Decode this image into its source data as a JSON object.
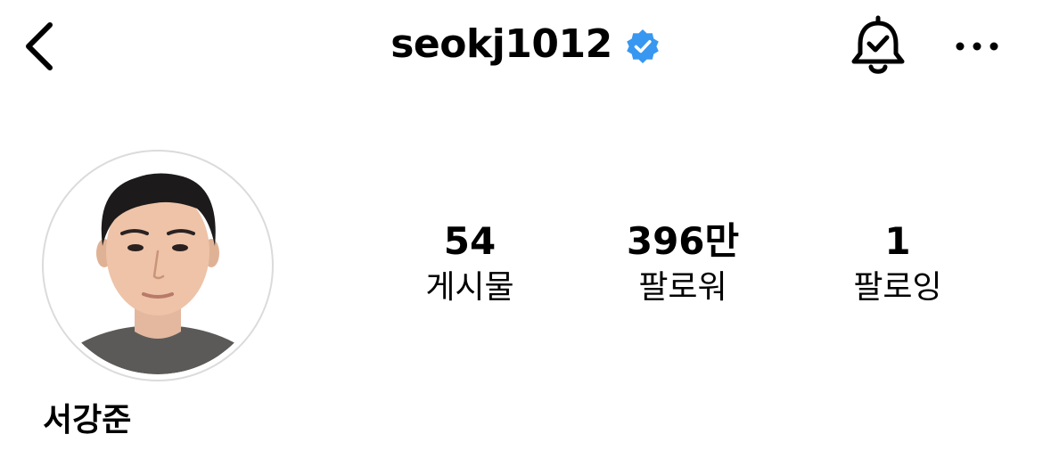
{
  "header": {
    "username": "seokj1012",
    "verified": true,
    "icons": {
      "back": "chevron-left-icon",
      "verified": "verified-badge-icon",
      "notifications": "bell-check-icon",
      "more": "more-horizontal-icon"
    }
  },
  "profile": {
    "display_name": "서강준",
    "avatar": "profile-photo"
  },
  "stats": [
    {
      "value": "54",
      "label": "게시물"
    },
    {
      "value": "396만",
      "label": "팔로워"
    },
    {
      "value": "1",
      "label": "팔로잉"
    }
  ],
  "colors": {
    "verified_blue": "#3897f0",
    "avatar_border": "#dbdbdb"
  }
}
